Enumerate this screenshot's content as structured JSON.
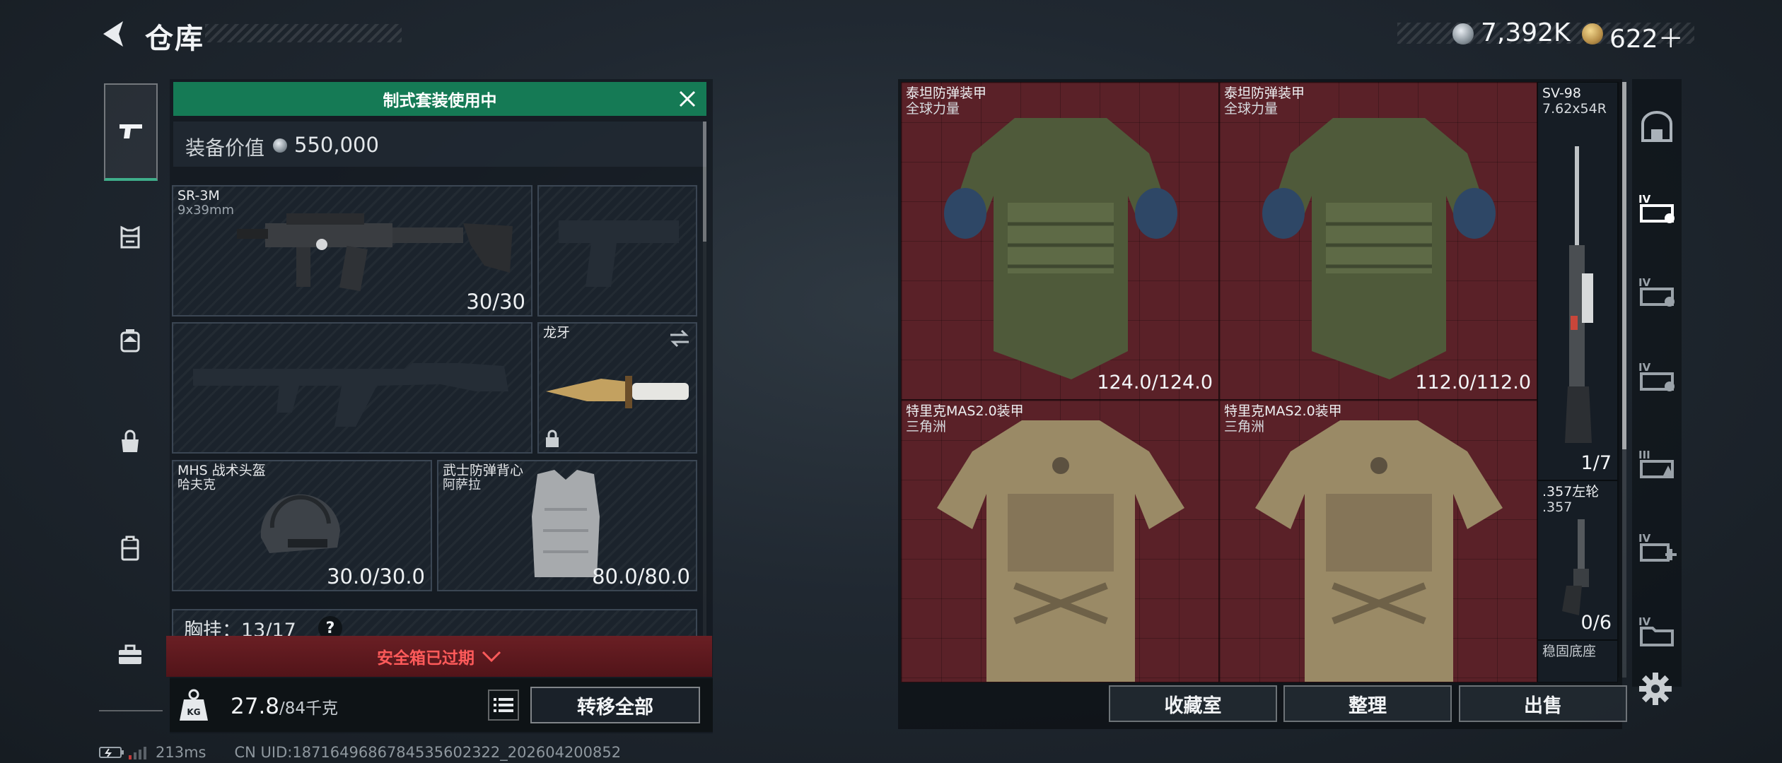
{
  "header": {
    "title": "仓库",
    "currency": [
      {
        "icon": "silver-coin-icon",
        "value": "7,392K"
      },
      {
        "icon": "gold-coin-icon",
        "value": "622＋"
      }
    ]
  },
  "categories": [
    {
      "name": "weapon-icon"
    },
    {
      "name": "chest-rig-icon"
    },
    {
      "name": "backpack-icon"
    },
    {
      "name": "bag-icon"
    },
    {
      "name": "case-icon"
    },
    {
      "name": "toolbox-icon"
    }
  ],
  "loadout": {
    "banner": "制式套装使用中",
    "value_label": "装备价值",
    "value": "550,000",
    "primary": {
      "name": "SR-3M",
      "caliber": "9x39mm",
      "durability": "30/30"
    },
    "melee": {
      "name": "龙牙"
    },
    "helmet": {
      "name": "MHS 战术头盔",
      "sub": "哈夫克",
      "durability": "30.0/30.0"
    },
    "vest": {
      "name": "武士防弹背心",
      "sub": "阿萨拉",
      "durability": "80.0/80.0"
    },
    "rig": {
      "label": "胸挂：",
      "count": "13/17",
      "help": "?"
    },
    "safe_box": "安全箱已过期",
    "weight": "27.8",
    "weight_max": "/84千克",
    "transfer_all": "转移全部"
  },
  "status": {
    "ping": "213ms",
    "uid": "CN UID:1871649686784535602322_202604200852"
  },
  "storage": {
    "items": [
      {
        "name": "泰坦防弹装甲",
        "sub": "全球力量",
        "durability": "124.0/124.0"
      },
      {
        "name": "泰坦防弹装甲",
        "sub": "全球力量",
        "durability": "112.0/112.0"
      },
      {
        "name": "特里克MAS2.0装甲",
        "sub": "三角洲"
      },
      {
        "name": "特里克MAS2.0装甲",
        "sub": "三角洲"
      },
      {
        "name": "SV-98",
        "sub": "7.62x54R",
        "durability": "1/7"
      },
      {
        "name": ".357左轮",
        "sub": ".357",
        "durability": "0/6"
      },
      {
        "name": "稳固底座"
      }
    ],
    "buttons": {
      "collection": "收藏室",
      "sort": "整理",
      "sell": "出售"
    }
  },
  "right_tabs": [
    {
      "name": "home-tab-icon"
    },
    {
      "name": "tier4-storage-tab-icon"
    },
    {
      "name": "tier4-storage-tab-2-icon"
    },
    {
      "name": "tier4-storage-tab-3-icon"
    },
    {
      "name": "tier3-storage-tab-icon"
    },
    {
      "name": "tier4-add-tab-icon"
    },
    {
      "name": "tier4-folder-tab-icon"
    }
  ],
  "colors": {
    "banner_green": "#157a55",
    "storage_cell_red": "#5a2128",
    "warning_red": "#ff5a5a",
    "selected_accent": "#3fae8a"
  }
}
